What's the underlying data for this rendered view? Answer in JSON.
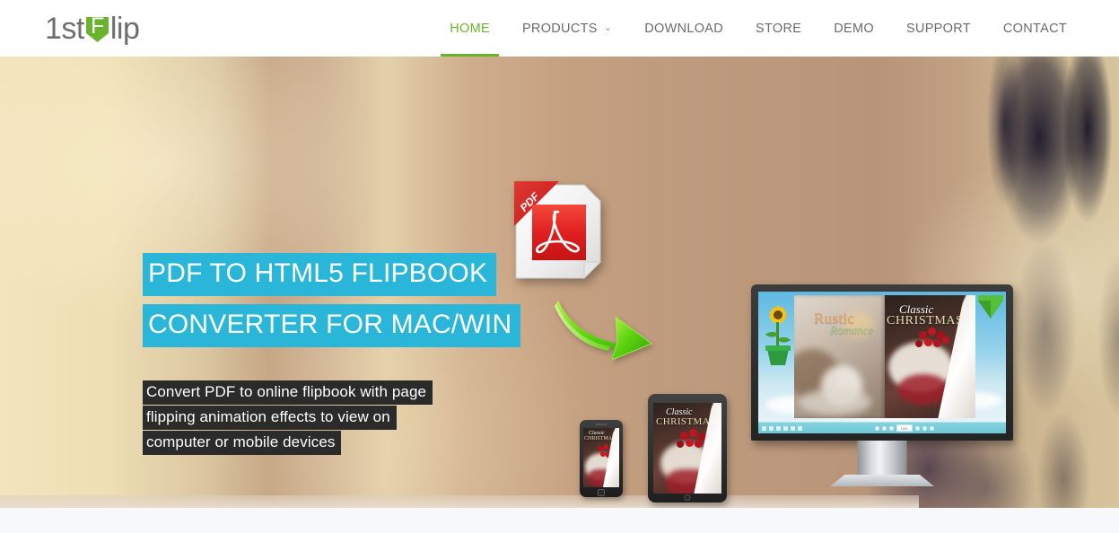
{
  "site": {
    "logo": {
      "part1": "1st",
      "badge_letter": "F",
      "part2": "lip",
      "badge_color": "#6ab42d"
    }
  },
  "nav": {
    "items": [
      {
        "label": "HOME",
        "active": true,
        "has_dropdown": false
      },
      {
        "label": "PRODUCTS",
        "active": false,
        "has_dropdown": true,
        "caret": "⌄"
      },
      {
        "label": "DOWNLOAD",
        "active": false,
        "has_dropdown": false
      },
      {
        "label": "STORE",
        "active": false,
        "has_dropdown": false
      },
      {
        "label": "DEMO",
        "active": false,
        "has_dropdown": false
      },
      {
        "label": "SUPPORT",
        "active": false,
        "has_dropdown": false
      },
      {
        "label": "CONTACT",
        "active": false,
        "has_dropdown": false
      }
    ],
    "active_color": "#6ab42d",
    "inactive_color": "#6b6b6b"
  },
  "hero": {
    "headline_lines": [
      "PDF TO HTML5 FLIPBOOK",
      "CONVERTER FOR MAC/WIN"
    ],
    "headline_highlight_color": "#29b6d8",
    "subhead_lines": [
      "Convert PDF to online flipbook with page",
      "flipping animation effects to view on",
      "computer or mobile devices"
    ],
    "subhead_highlight_color": "#2b2b2b",
    "pdf_icon": {
      "ribbon_label": "PDF",
      "accent_color": "#e02020"
    },
    "arrow": {
      "color": "#4fc410"
    },
    "flipbook": {
      "left_page": {
        "title_main": "Rustic",
        "title_script": "Romance",
        "title_main_color": "#e2a269",
        "title_script_color": "#9fc08a"
      },
      "right_page": {
        "title_script": "Classic",
        "title_main": "CHRISTMAS",
        "title_script_color": "#ffffff",
        "title_main_color": "#e8dcb4"
      },
      "toolbar": {
        "page_indicator": "1/20",
        "accent_color": "#6cc6d6"
      }
    }
  }
}
